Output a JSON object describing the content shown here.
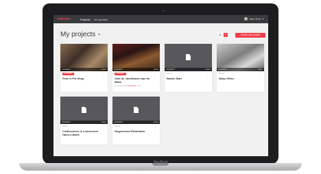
{
  "device": {
    "brand": "MacBook"
  },
  "topbar": {
    "logo": "interact",
    "nav": [
      "Projects",
      "Ml updates"
    ],
    "user": {
      "name": "John Doe"
    }
  },
  "page": {
    "title": "My projects"
  },
  "toolbar": {
    "create_label": "Create new project"
  },
  "projects": [
    {
      "badge": "CONCEPT",
      "title": "Peter's Pet Shop",
      "date": "10/10/2017",
      "status": "Active",
      "stats": ""
    },
    {
      "badge": "CONCEPT",
      "title": "Café de Jachthaven aan de Maas",
      "date": "10/10/2017",
      "status": "Active",
      "stats_a": "● 3/4   ● 1/4",
      "stats_b": "● 1 outstanding",
      "stats_c": "● 3/4"
    },
    {
      "type": "Private",
      "title": "Barber Bart",
      "date": "10/10/2017",
      "status": "Active"
    },
    {
      "type": "Private",
      "title": "Warp Office",
      "date": "10/10/2017",
      "status": "Active"
    },
    {
      "type": "Private",
      "title": "Coffeecorner & Lunchroom Hans-n-Boek",
      "date": "10/10/2017",
      "status": "Active"
    },
    {
      "type": "Private",
      "title": "Hogeschool Rotterdam",
      "date": "10/10/2017",
      "status": "Active"
    }
  ],
  "colors": {
    "accent": "#ef3e49",
    "topbar": "#3b3b3e",
    "screen_bg": "#f1f1f1"
  },
  "icons": [
    "document-icon",
    "kebab-menu-icon",
    "grid-view-icon",
    "list-view-icon",
    "chevron-down-icon",
    "avatar"
  ]
}
